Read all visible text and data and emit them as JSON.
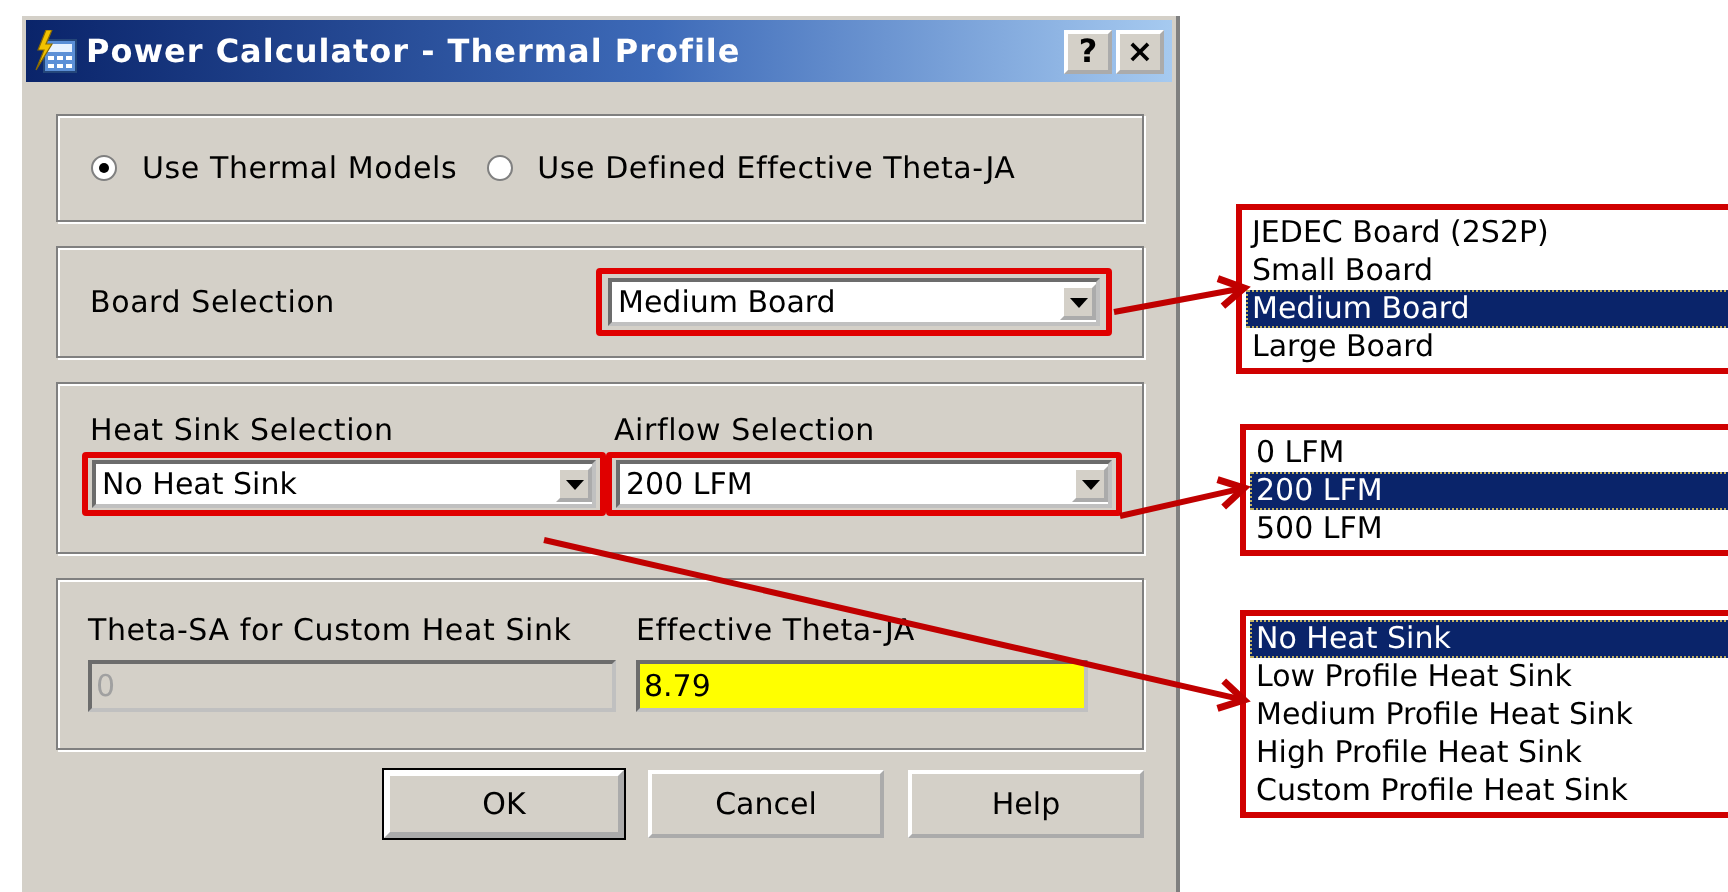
{
  "window": {
    "title": "Power Calculator - Thermal Profile",
    "title_buttons": [
      "?",
      "×"
    ]
  },
  "model_options": [
    {
      "label": "Use Thermal Models",
      "selected": true
    },
    {
      "label": "Use Defined Effective Theta-JA",
      "selected": false
    }
  ],
  "board_selection": {
    "label": "Board Selection",
    "value": "Medium Board",
    "highlighted": true
  },
  "heat_sink_selection": {
    "label": "Heat Sink Selection",
    "value": "No Heat Sink",
    "highlighted": true
  },
  "airflow_selection": {
    "label": "Airflow Selection",
    "value": "200 LFM",
    "highlighted": true
  },
  "theta_sa": {
    "label": "Theta-SA for Custom Heat Sink",
    "value": "0",
    "disabled": true
  },
  "effective_theta_ja": {
    "label": "Effective Theta-JA",
    "value": "8.79",
    "highlighted": true
  },
  "buttons": [
    {
      "label": "OK",
      "default": true
    },
    {
      "label": "Cancel",
      "default": false
    },
    {
      "label": "Help",
      "default": false
    }
  ],
  "dropdown_lists": [
    {
      "items": [
        {
          "label": "JEDEC Board (2S2P)",
          "selected": false
        },
        {
          "label": "Small Board",
          "selected": false
        },
        {
          "label": "Medium Board",
          "selected": true
        },
        {
          "label": "Large Board",
          "selected": false
        }
      ]
    },
    {
      "items": [
        {
          "label": "0 LFM",
          "selected": false
        },
        {
          "label": "200 LFM",
          "selected": true
        },
        {
          "label": "500 LFM",
          "selected": false
        }
      ]
    },
    {
      "items": [
        {
          "label": "No Heat Sink",
          "selected": true
        },
        {
          "label": "Low Profile Heat Sink",
          "selected": false
        },
        {
          "label": "Medium Profile Heat Sink",
          "selected": false
        },
        {
          "label": "High Profile Heat Sink",
          "selected": false
        },
        {
          "label": "Custom Profile Heat Sink",
          "selected": false
        }
      ]
    }
  ]
}
